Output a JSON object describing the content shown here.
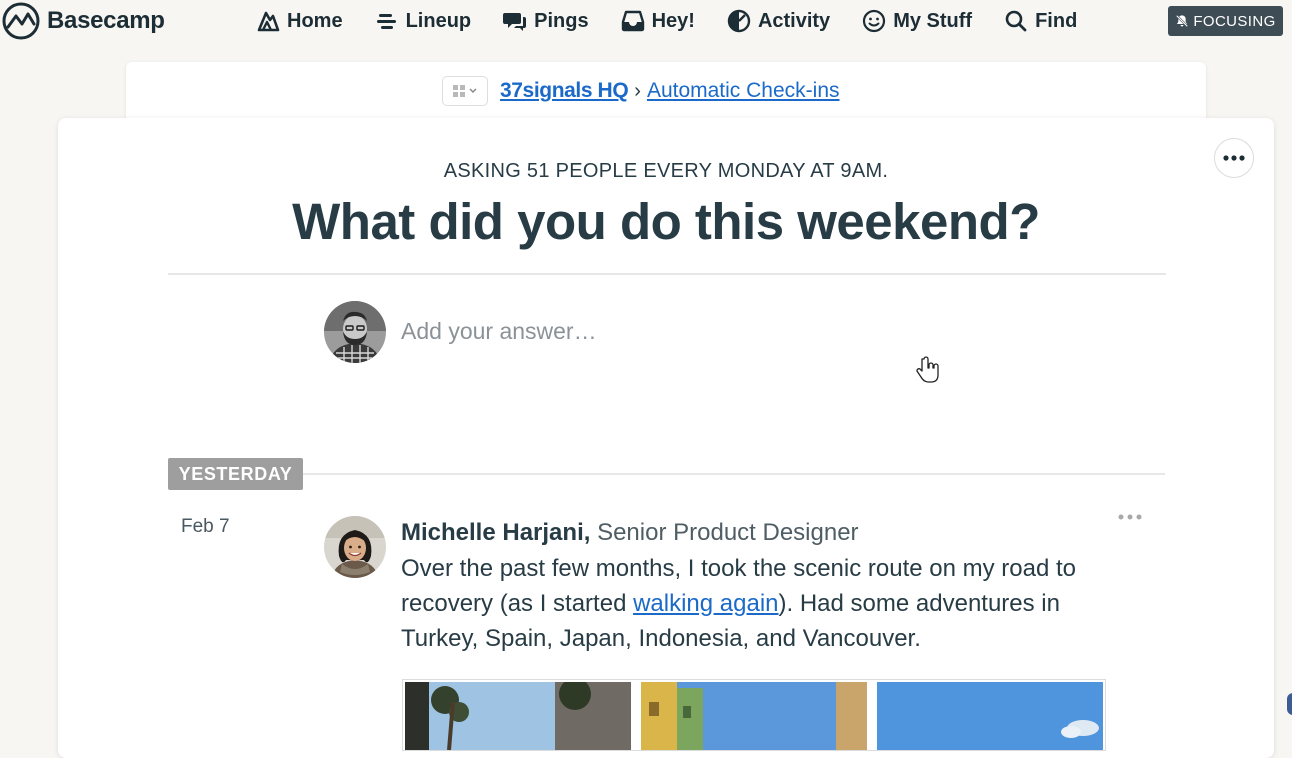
{
  "app": {
    "name": "Basecamp"
  },
  "nav": {
    "items": [
      {
        "label": "Home",
        "icon": "home-icon"
      },
      {
        "label": "Lineup",
        "icon": "lineup-icon"
      },
      {
        "label": "Pings",
        "icon": "pings-icon"
      },
      {
        "label": "Hey!",
        "icon": "hey-icon"
      },
      {
        "label": "Activity",
        "icon": "activity-icon"
      },
      {
        "label": "My Stuff",
        "icon": "my-stuff-icon"
      },
      {
        "label": "Find",
        "icon": "search-icon"
      }
    ],
    "focusing_label": "FOCUSING"
  },
  "breadcrumb": {
    "project": "37signals HQ",
    "separator": "›",
    "tool": "Automatic Check-ins"
  },
  "checkin": {
    "schedule": "ASKING 51 PEOPLE EVERY MONDAY AT 9AM.",
    "question": "What did you do this weekend?",
    "answer_placeholder": "Add your answer…"
  },
  "group": {
    "label": "YESTERDAY"
  },
  "entry": {
    "date": "Feb 7",
    "author": "Michelle Harjani,",
    "role": "Senior Product Designer",
    "text_before_link": "Over the past few months, I took the scenic route on my road to recovery (as I started ",
    "link_text": "walking again",
    "text_after_link": "). Had some adventures in Turkey, Spain, Japan, Indonesia, and Vancouver."
  },
  "colors": {
    "ink": "#283c46",
    "link": "#1b6ac9",
    "badge": "#9e9e9e",
    "focus_button": "#3e4c55",
    "page_bg": "#f7f6f2"
  }
}
